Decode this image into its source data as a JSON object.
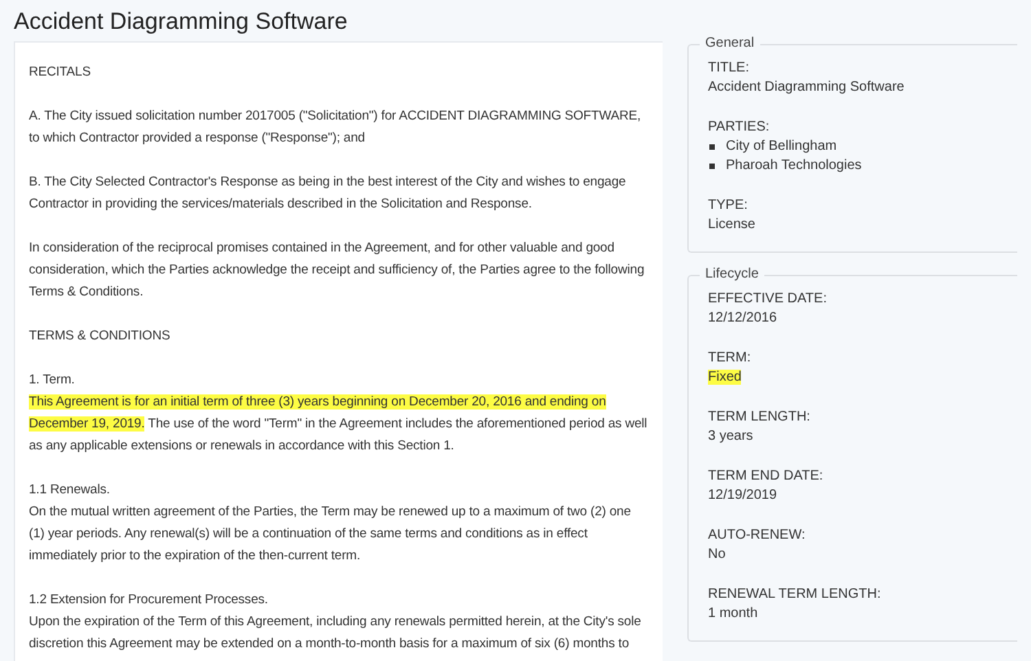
{
  "page_title": "Accident Diagramming Software",
  "document": {
    "paragraphs": [
      {
        "segments": [
          {
            "text": "RECITALS",
            "highlighted": false
          }
        ]
      },
      {
        "segments": [
          {
            "text": "A. The City issued solicitation number 2017005 (\"Solicitation\") for ACCIDENT DIAGRAMMING SOFTWARE, to which Contractor provided a response (\"Response\"); and",
            "highlighted": false
          }
        ]
      },
      {
        "segments": [
          {
            "text": "B. The City Selected Contractor's Response as being in the best interest of the City and wishes to engage Contractor in providing the services/materials described in the Solicitation and Response.",
            "highlighted": false
          }
        ]
      },
      {
        "segments": [
          {
            "text": "In consideration of the reciprocal promises contained in the Agreement, and for other valuable and good consideration, which the Parties acknowledge the receipt and sufficiency of, the Parties agree to the following Terms & Conditions.",
            "highlighted": false
          }
        ]
      },
      {
        "segments": [
          {
            "text": "TERMS & CONDITIONS",
            "highlighted": false
          }
        ]
      },
      {
        "heading": "1. Term.",
        "segments": [
          {
            "text": "This Agreement is for an initial term of three (3) years beginning on December 20, 2016 and ending on December 19, 2019.",
            "highlighted": true
          },
          {
            "text": " The use of the word \"Term\" in the Agreement includes the aforementioned period as well as any applicable extensions or renewals in accordance with this Section 1.",
            "highlighted": false
          }
        ]
      },
      {
        "heading": "1.1 Renewals.",
        "segments": [
          {
            "text": "On the mutual written agreement of the Parties, the Term may be renewed up to a maximum of two (2) one (1) year periods. Any renewal(s) will be a continuation of the same terms and conditions as in effect immediately prior to the expiration of the then-current term.",
            "highlighted": false
          }
        ]
      },
      {
        "heading": "1.2 Extension for Procurement Processes.",
        "segments": [
          {
            "text": "Upon the expiration of the Term of this Agreement, including any renewals permitted herein, at the City's sole discretion this Agreement may be extended on a month-to-month basis for a maximum of six (6) months to",
            "highlighted": false
          }
        ]
      }
    ]
  },
  "sections": [
    {
      "legend": "General",
      "fields": [
        {
          "label": "TITLE:",
          "value": "Accident Diagramming Software",
          "highlighted": false
        },
        {
          "label": "PARTIES:",
          "items": [
            "City of Bellingham",
            "Pharoah Technologies"
          ]
        },
        {
          "label": "TYPE:",
          "value": "License",
          "highlighted": false
        }
      ]
    },
    {
      "legend": "Lifecycle",
      "fields": [
        {
          "label": "EFFECTIVE DATE:",
          "value": "12/12/2016",
          "highlighted": false
        },
        {
          "label": "TERM:",
          "value": "Fixed",
          "highlighted": true
        },
        {
          "label": "TERM LENGTH:",
          "value": "3 years",
          "highlighted": false
        },
        {
          "label": "TERM END DATE:",
          "value": "12/19/2019",
          "highlighted": false
        },
        {
          "label": "AUTO-RENEW:",
          "value": "No",
          "highlighted": false
        },
        {
          "label": "RENEWAL TERM LENGTH:",
          "value": "1 month",
          "highlighted": false
        }
      ]
    }
  ]
}
